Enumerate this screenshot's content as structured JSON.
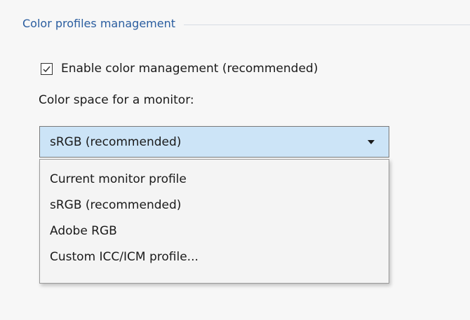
{
  "section": {
    "title": "Color profiles management"
  },
  "color_management_checkbox": {
    "label": "Enable color management (recommended)",
    "checked": true
  },
  "color_space": {
    "label": "Color space for a monitor:",
    "selected_value": "sRGB (recommended)",
    "options": [
      "Current monitor profile",
      "sRGB (recommended)",
      "Adobe RGB",
      "Custom ICC/ICM profile..."
    ]
  },
  "icons": {
    "checkbox_check": "checkmark-icon",
    "dropdown_arrow": "chevron-down-icon"
  },
  "colors": {
    "section_title": "#2a5d9f",
    "dropdown_selected_background": "#cce4f7",
    "menu_background": "#f4f4f4"
  }
}
